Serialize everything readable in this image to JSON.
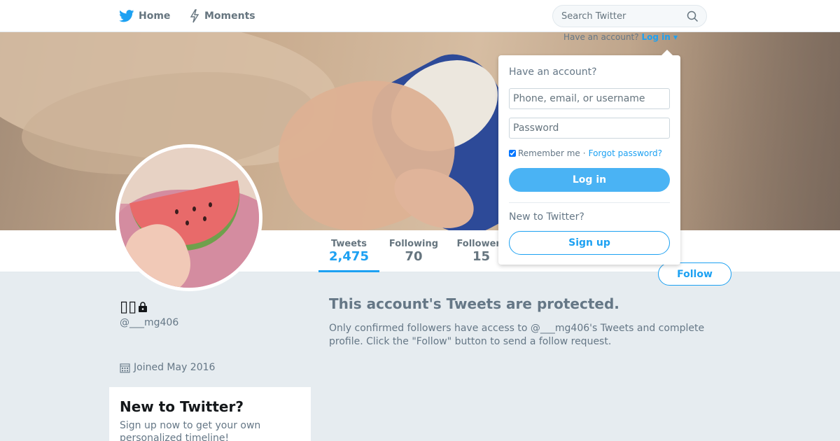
{
  "nav": {
    "home_label": "Home",
    "moments_label": "Moments",
    "search_placeholder": "Search Twitter"
  },
  "header_login": {
    "prefix": "Have an account?",
    "link": "Log in ▾"
  },
  "login_dropdown": {
    "heading": "Have an account?",
    "username_placeholder": "Phone, email, or username",
    "password_placeholder": "Password",
    "remember_label": "Remember me",
    "separator": "·",
    "forgot_label": "Forgot password?",
    "login_button": "Log in",
    "new_heading": "New to Twitter?",
    "signup_button": "Sign up"
  },
  "profile": {
    "name": "▯▯",
    "handle": "@___mg406",
    "joined": "Joined May 2016"
  },
  "stats": [
    {
      "label": "Tweets",
      "value": "2,475"
    },
    {
      "label": "Following",
      "value": "70"
    },
    {
      "label": "Followers",
      "value": "15"
    }
  ],
  "follow_button": "Follow",
  "protected": {
    "title": "This account's Tweets are protected.",
    "body": "Only confirmed followers have access to @___mg406's Tweets and complete profile. Click the \"Follow\" button to send a follow request."
  },
  "signup_box": {
    "title": "New to Twitter?",
    "body": "Sign up now to get your own personalized timeline!"
  },
  "colors": {
    "accent": "#1da1f2",
    "background": "#e6ecf0"
  },
  "icons": {
    "home": "twitter-bird-icon",
    "moments": "lightning-icon",
    "search": "search-icon",
    "lock": "lock-icon",
    "calendar": "calendar-icon"
  }
}
